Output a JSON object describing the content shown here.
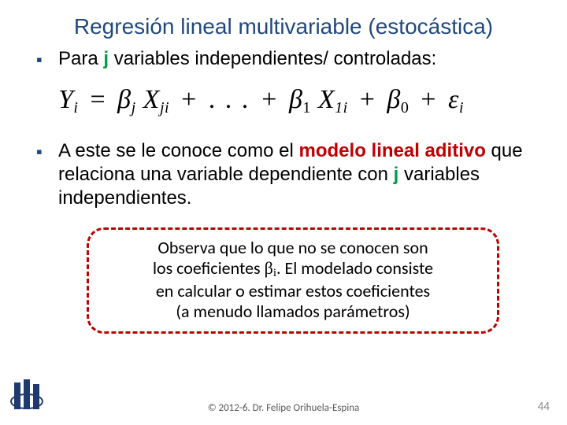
{
  "title": "Regresión lineal multivariable (estocástica)",
  "bullets": {
    "b1_pre": "Para ",
    "b1_j": "j",
    "b1_post": " variables independientes/ controladas:",
    "b2_pre": "A este se le conoce como el ",
    "b2_term": "modelo lineal aditivo",
    "b2_mid": " que relaciona una variable dependiente con ",
    "b2_j": "j",
    "b2_post": " variables independientes."
  },
  "equation": {
    "Y": "Y",
    "Ysub": "i",
    "eq": " = ",
    "b_j": "β",
    "b_j_sub": "j",
    "X_j": "X",
    "X_j_sub": "ji",
    "plus1": "+",
    "dots": ". . .",
    "plus2": "+",
    "b_1": "β",
    "b_1_sub": "1",
    "X_1": "X",
    "X_1_sub": "1i",
    "plus3": "+",
    "b_0": "β",
    "b_0_sub": "0",
    "plus4": "+",
    "eps": "ε",
    "eps_sub": "i"
  },
  "callout": {
    "line1": "Observa que lo que no se conocen son",
    "line2a": "los coeficientes ",
    "beta": "β",
    "betasub": "i",
    "line2b": ". El modelado consiste",
    "line3": "en calcular o estimar estos coeficientes",
    "line4": "(a menudo llamados parámetros)"
  },
  "footer": "© 2012-6. Dr. Felipe Orihuela-Espina",
  "page": "44"
}
